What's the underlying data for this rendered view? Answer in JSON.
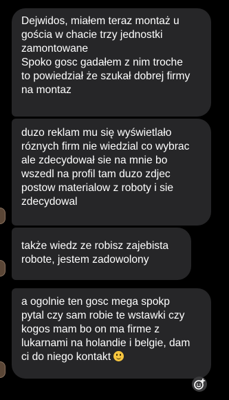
{
  "messages": [
    {
      "lines": [
        "Dejwidos, miałem teraz montaż u",
        "gościa w chacie trzy jednostki",
        "zamontowane",
        "Spoko gosc gadałem z nim troche",
        "to powiedział że szukał dobrej firmy",
        "na montaz"
      ]
    },
    {
      "lines": [
        "duzo reklam mu się wyświetlało",
        "róznych firm nie wiedzial co wybrac",
        "ale zdecydował sie na mnie bo",
        "wszedl na profil tam duzo zdjec",
        "postow materialow z roboty i sie",
        "zdecydowal"
      ]
    },
    {
      "lines": [
        "także wiedz ze robisz zajebista",
        "robote, jestem zadowolony"
      ]
    },
    {
      "lines": [
        "a ogolnie ten gosc mega spokp",
        "pytal czy sam robie te wstawki czy",
        "kogos mam bo on ma firme z",
        "lukarnami na holandie i belgie, dam",
        "ci do niego kontakt"
      ],
      "trailing_emoji": "slightly-smiling-face"
    }
  ],
  "colors": {
    "background": "#000000",
    "bubble": "#262628",
    "text": "#ffffff"
  },
  "icons": {
    "add_reaction": "smiley-plus-icon"
  }
}
